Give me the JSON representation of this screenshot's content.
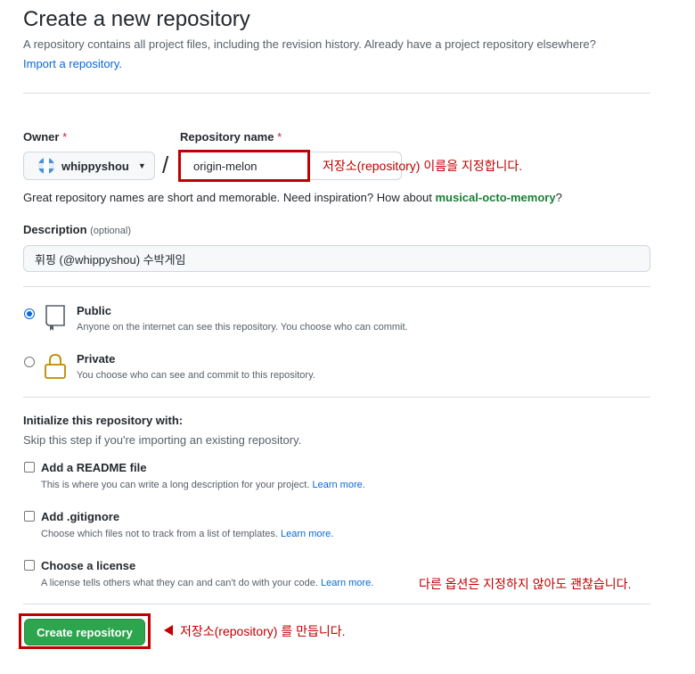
{
  "header": {
    "title": "Create a new repository",
    "subtitle": "A repository contains all project files, including the revision history. Already have a project repository elsewhere?",
    "import_link": "Import a repository."
  },
  "owner": {
    "label": "Owner",
    "required_mark": "*",
    "value": "whippyshou"
  },
  "repo_name": {
    "label": "Repository name",
    "required_mark": "*",
    "value": "origin-melon"
  },
  "slash": "/",
  "hint": {
    "text": "Great repository names are short and memorable. Need inspiration? How about ",
    "suggestion": "musical-octo-memory",
    "end": "?"
  },
  "description": {
    "label": "Description",
    "optional": "(optional)",
    "value": "휘핑 (@whippyshou) 수박게임"
  },
  "visibility": {
    "selected": "public",
    "public_title": "Public",
    "public_desc": "Anyone on the internet can see this repository. You choose who can commit.",
    "private_title": "Private",
    "private_desc": "You choose who can see and commit to this repository."
  },
  "init": {
    "title": "Initialize this repository with:",
    "subtitle": "Skip this step if you're importing an existing repository.",
    "readme_title": "Add a README file",
    "readme_desc": "This is where you can write a long description for your project.",
    "gitignore_title": "Add .gitignore",
    "gitignore_desc": "Choose which files not to track from a list of templates.",
    "license_title": "Choose a license",
    "license_desc": "A license tells others what they can and can't do with your code.",
    "learn_more": "Learn more."
  },
  "create_button": "Create repository",
  "annotations": {
    "repo_name_note": "저장소(repository) 이름을 지정합니다.",
    "other_options_note": "다른 옵션은 지정하지 않아도 괜찮습니다.",
    "create_note": "저장소(repository) 를 만듭니다.",
    "color": "#c00000"
  },
  "colors": {
    "primary_button": "#2da44e",
    "link": "#0969da",
    "suggestion": "#1a7f37",
    "required": "#cf222e"
  }
}
